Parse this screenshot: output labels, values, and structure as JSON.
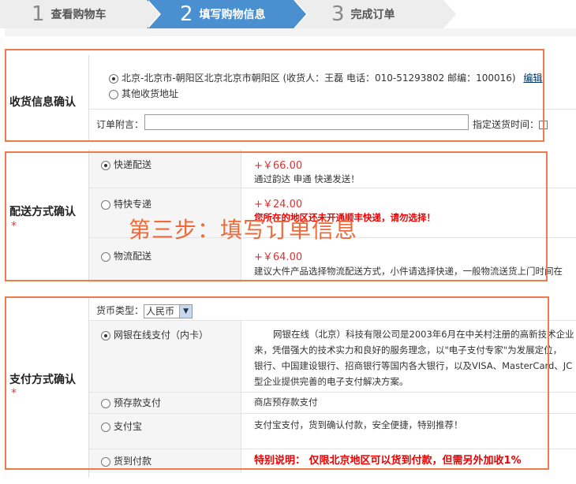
{
  "steps": [
    {
      "num": "1",
      "label": "查看购物车"
    },
    {
      "num": "2",
      "label": "填写购物信息"
    },
    {
      "num": "3",
      "label": "完成订单"
    }
  ],
  "shipping_info": {
    "title": "收货信息确认",
    "address_option": "北京-北京市-朝阳区北京北京市朝阳区 (收货人：王磊 电话：010-51293802 邮编：100016)",
    "edit_link": "编辑",
    "other_option": "其他收货地址",
    "note_label": "订单附言：",
    "note_value": "",
    "delivery_time_label": "指定送货时间："
  },
  "delivery": {
    "title": "配送方式确认",
    "star": "*",
    "options": [
      {
        "name": "快递配送",
        "price": "+￥66.00",
        "desc": "通过韵达 申通 快递发送！",
        "selected": true
      },
      {
        "name": "特快专递",
        "price": "+￥24.00",
        "desc": "您所在的地区还未开通顺丰快递，请勿选择！",
        "selected": false
      },
      {
        "name": "物流配送",
        "price": "+￥64.00",
        "desc": "建议大件产品选择物流配送方式，小件请选择快递，一般物流送货上门时间在",
        "selected": false
      }
    ]
  },
  "overlay_text": "第三步：填写订单信息",
  "payment": {
    "title": "支付方式确认",
    "star": "*",
    "currency_label": "货币类型：",
    "currency_value": "人民币",
    "options": [
      {
        "name": "网银在线支付（内卡）",
        "selected": true,
        "desc_lines": [
          "网银在线（北京）科技有限公司是2003年6月在中关村注册的高新技术企业",
          "来，凭借强大的技术实力和良好的服务理念，以\"电子支付专家\"为发展定位，",
          "银行、中国建设银行、招商银行等国内各大银行，以及VISA、MasterCard、JC",
          "型企业提供完善的电子支付解决方案。"
        ]
      },
      {
        "name": "预存款支付",
        "selected": false,
        "desc": "商店预存款支付"
      },
      {
        "name": "支付宝",
        "selected": false,
        "desc": "支付宝支付，货到确认付款，安全便捷，特别推荐！"
      },
      {
        "name": "货到付款",
        "selected": false,
        "desc": "特别说明：  仅限北京地区可以货到付款，但需另外加收1%"
      }
    ]
  }
}
